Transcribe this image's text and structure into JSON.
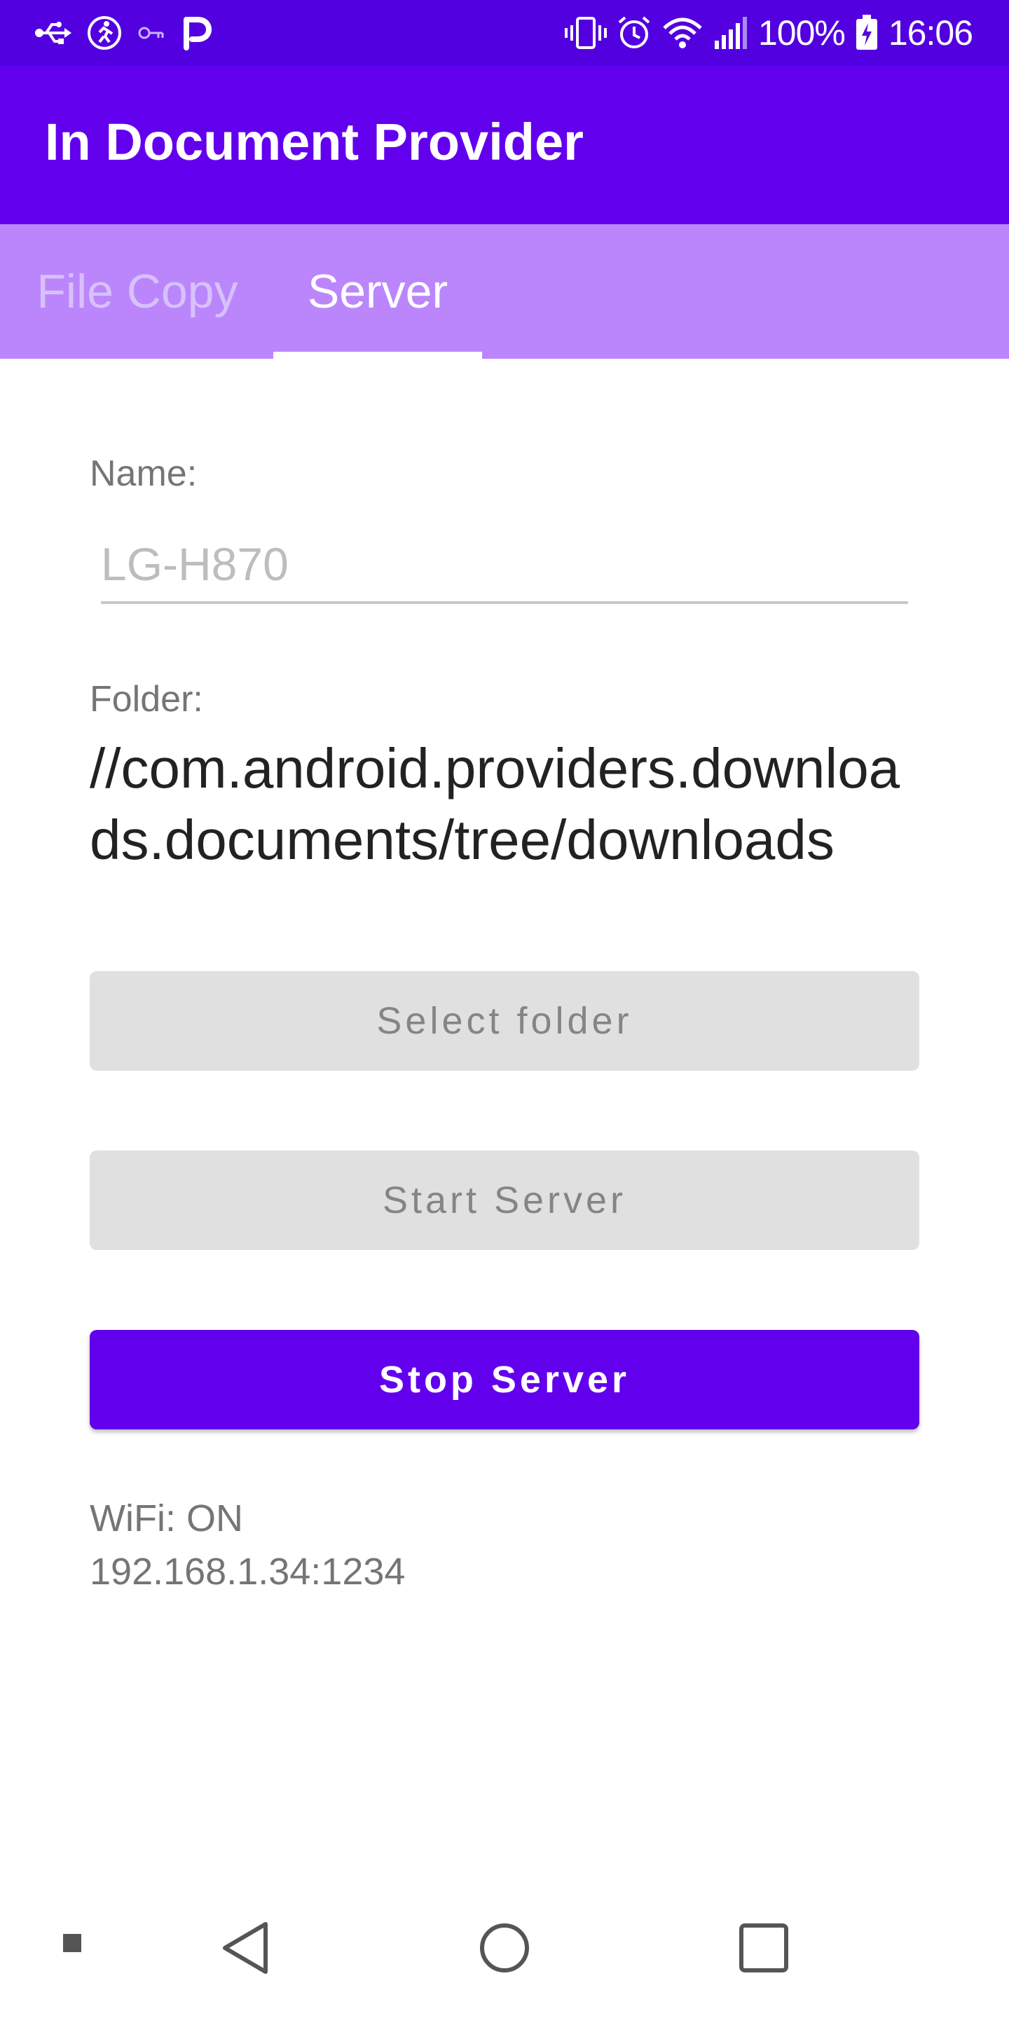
{
  "status_bar": {
    "left_icons": [
      "usb-icon",
      "running-person-icon",
      "key-icon",
      "p-app-icon"
    ],
    "right_icons": [
      "vibrate-icon",
      "alarm-icon",
      "wifi-icon",
      "signal-icon",
      "battery-charging-icon"
    ],
    "battery": "100%",
    "time": "16:06"
  },
  "app_bar": {
    "title": "In Document Provider"
  },
  "tabs": [
    {
      "label": "File Copy",
      "selected": false
    },
    {
      "label": "Server",
      "selected": true
    }
  ],
  "form": {
    "name_label": "Name:",
    "name_value": "",
    "name_placeholder": "LG-H870",
    "folder_label": "Folder:",
    "folder_path": "//com.android.providers.downloads.documents/tree/downloads"
  },
  "buttons": {
    "select_folder": "Select folder",
    "start_server": "Start Server",
    "stop_server": "Stop Server"
  },
  "network": {
    "wifi_status": "WiFi: ON",
    "address": "192.168.1.34:1234"
  },
  "nav_bar": {
    "items": [
      "menu-dot-icon",
      "back-icon",
      "home-icon",
      "recents-icon"
    ]
  },
  "colors": {
    "status_bar": "#5300e0",
    "app_bar": "#6200ee",
    "tab_bar": "#bb86fc",
    "primary_button": "#6200ee",
    "disabled_button": "#e0e0e0"
  }
}
